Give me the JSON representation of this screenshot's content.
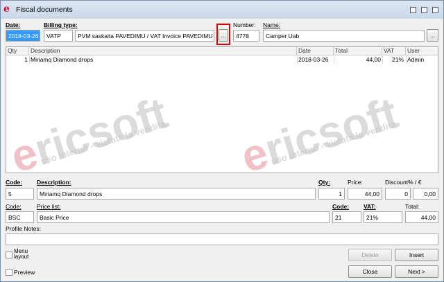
{
  "window": {
    "title": "Fiscal documents",
    "app_icon": "e"
  },
  "header": {
    "date_label": "Date:",
    "date_value": "2018-03-26",
    "billing_label": "Billing type:",
    "billing_code": "VATP",
    "billing_desc": "PVM saskaita PAVEDIMU / VAT Invoice PAVEDIMU",
    "lookup_label": "...",
    "number_label": "Number:",
    "number_value": "4778",
    "name_label": "Name:",
    "name_value": "Camper Uab",
    "name_lookup_label": "..."
  },
  "grid": {
    "columns": [
      "Qty",
      "Description",
      "Date",
      "Total",
      "VAT",
      "User"
    ],
    "rows": [
      {
        "qty": "1",
        "description": "Miriamq Diamond drops",
        "date": "2018-03-26",
        "total": "44,00",
        "vat": "21%",
        "user": "Admin"
      }
    ]
  },
  "watermark": {
    "brand": "ericsoft",
    "caption": "uso interno - vietata la vendita"
  },
  "line": {
    "code_label": "Code:",
    "code_value": "5",
    "desc_label": "Description:",
    "desc_value": "Miriamq Diamond drops",
    "qty_label": "Qty:",
    "qty_value": "1",
    "price_label": "Price:",
    "price_value": "44,00",
    "discount_label": "Discount% / €",
    "discount_pct": "0",
    "discount_abs": "0,00",
    "code2_label": "Code:",
    "code2_value": "BSC",
    "pricelist_label": "Price list:",
    "pricelist_value": "Basic Price",
    "vatcode_label": "Code:",
    "vatcode_value": "21",
    "vat_label": "VAT:",
    "vat_value": "21%",
    "total_label": "Total:",
    "total_value": "44,00",
    "profile_label": "Profile Notes:",
    "profile_value": ""
  },
  "footer": {
    "menu_label": "Menu\nlayout",
    "preview_label": "Preview",
    "delete_label": "Delete",
    "insert_label": "Insert",
    "close_label": "Close",
    "next_label": "Next >"
  },
  "colors": {
    "accent_red": "#e00000",
    "brand_red": "#c8102e"
  }
}
